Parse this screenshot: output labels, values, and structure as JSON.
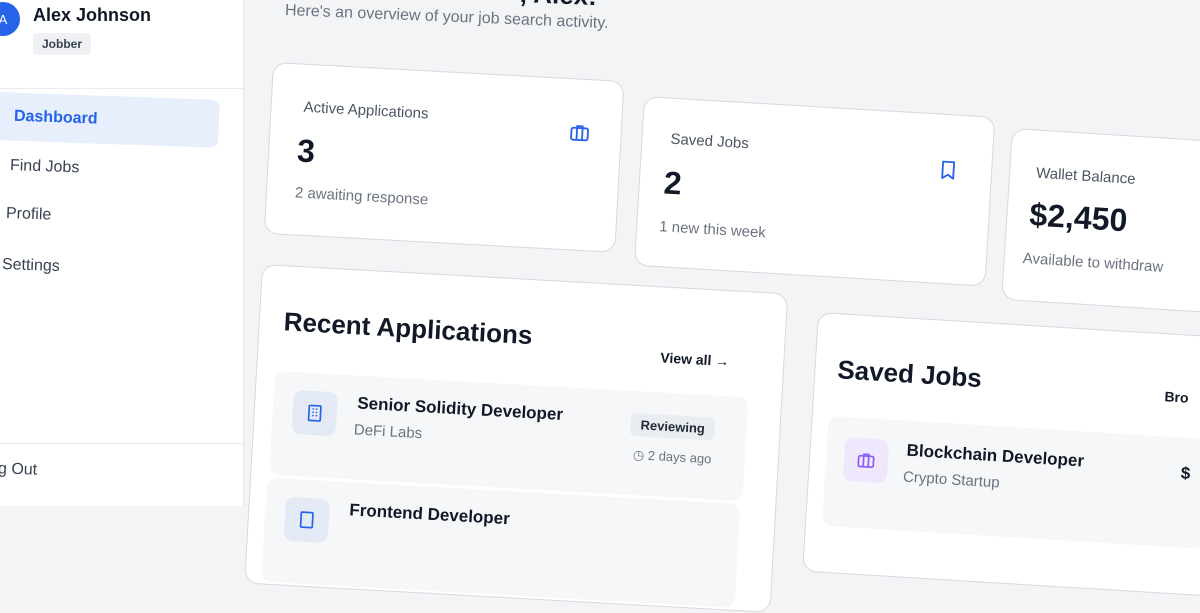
{
  "user": {
    "avatar_letter": "A",
    "name": "Alex Johnson",
    "role": "Jobber"
  },
  "nav": {
    "items": [
      {
        "label": "Dashboard",
        "active": true
      },
      {
        "label": "Find Jobs",
        "active": false
      },
      {
        "label": "Profile",
        "active": false
      },
      {
        "label": "Settings",
        "active": false
      }
    ],
    "logout_label": "g Out"
  },
  "header": {
    "title_partial": ", Alex!",
    "subtitle": "Here's an overview of your job search activity."
  },
  "stats": [
    {
      "label": "Active Applications",
      "value": "3",
      "sub": "2 awaiting response",
      "icon": "briefcase-icon"
    },
    {
      "label": "Saved Jobs",
      "value": "2",
      "sub": "1 new this week",
      "icon": "bookmark-icon"
    },
    {
      "label": "Wallet Balance",
      "value": "$2,450",
      "sub": "Available to withdraw",
      "icon": "wallet-icon"
    }
  ],
  "recent_applications": {
    "title": "Recent Applications",
    "view_all": "View all",
    "items": [
      {
        "title": "Senior Solidity Developer",
        "company": "DeFi Labs",
        "status": "Reviewing",
        "time": "2 days ago"
      },
      {
        "title": "Frontend Developer",
        "company": "",
        "status": "",
        "time": ""
      }
    ]
  },
  "saved_jobs": {
    "title": "Saved Jobs",
    "browse_partial": "Bro",
    "items": [
      {
        "title": "Blockchain Developer",
        "company": "Crypto Startup",
        "price_partial": "$"
      }
    ]
  },
  "colors": {
    "accent": "#2563eb",
    "purple": "#8b5cf6",
    "bg": "#f3f4f6"
  }
}
